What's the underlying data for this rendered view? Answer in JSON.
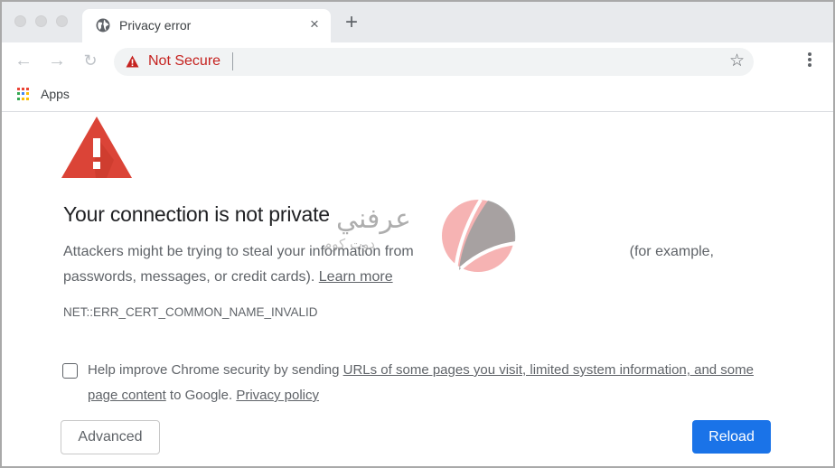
{
  "browser": {
    "tab": {
      "title": "Privacy error",
      "favicon": "globe-icon",
      "close_glyph": "×"
    },
    "new_tab_glyph": "+",
    "nav": {
      "back_glyph": "←",
      "forward_glyph": "→",
      "reload_glyph": "↻"
    },
    "omnibox": {
      "security_label": "Not Secure",
      "value": "",
      "security_color": "#c5221f",
      "bookmark_glyph": "☆"
    },
    "bookmarks_bar": {
      "apps_label": "Apps"
    }
  },
  "page": {
    "headline": "Your connection is not private",
    "paragraph_part1": "Attackers might be trying to steal your information from",
    "paragraph_part2": "(for example, passwords, messages, or credit cards).",
    "learn_more": "Learn more",
    "error_code": "NET::ERR_CERT_COMMON_NAME_INVALID",
    "optin": {
      "checked": false,
      "text_before": "Help improve Chrome security by sending",
      "link1": "URLs of some pages you visit, limited system information, and some page content",
      "text_middle": "to Google.",
      "link2": "Privacy policy"
    },
    "buttons": {
      "advanced": "Advanced",
      "reload": "Reload"
    },
    "colors": {
      "warning_red": "#db4437",
      "primary_blue": "#1a73e8"
    }
  },
  "watermark": {
    "line1": "عرفني",
    "line2": "دوت كوم"
  }
}
